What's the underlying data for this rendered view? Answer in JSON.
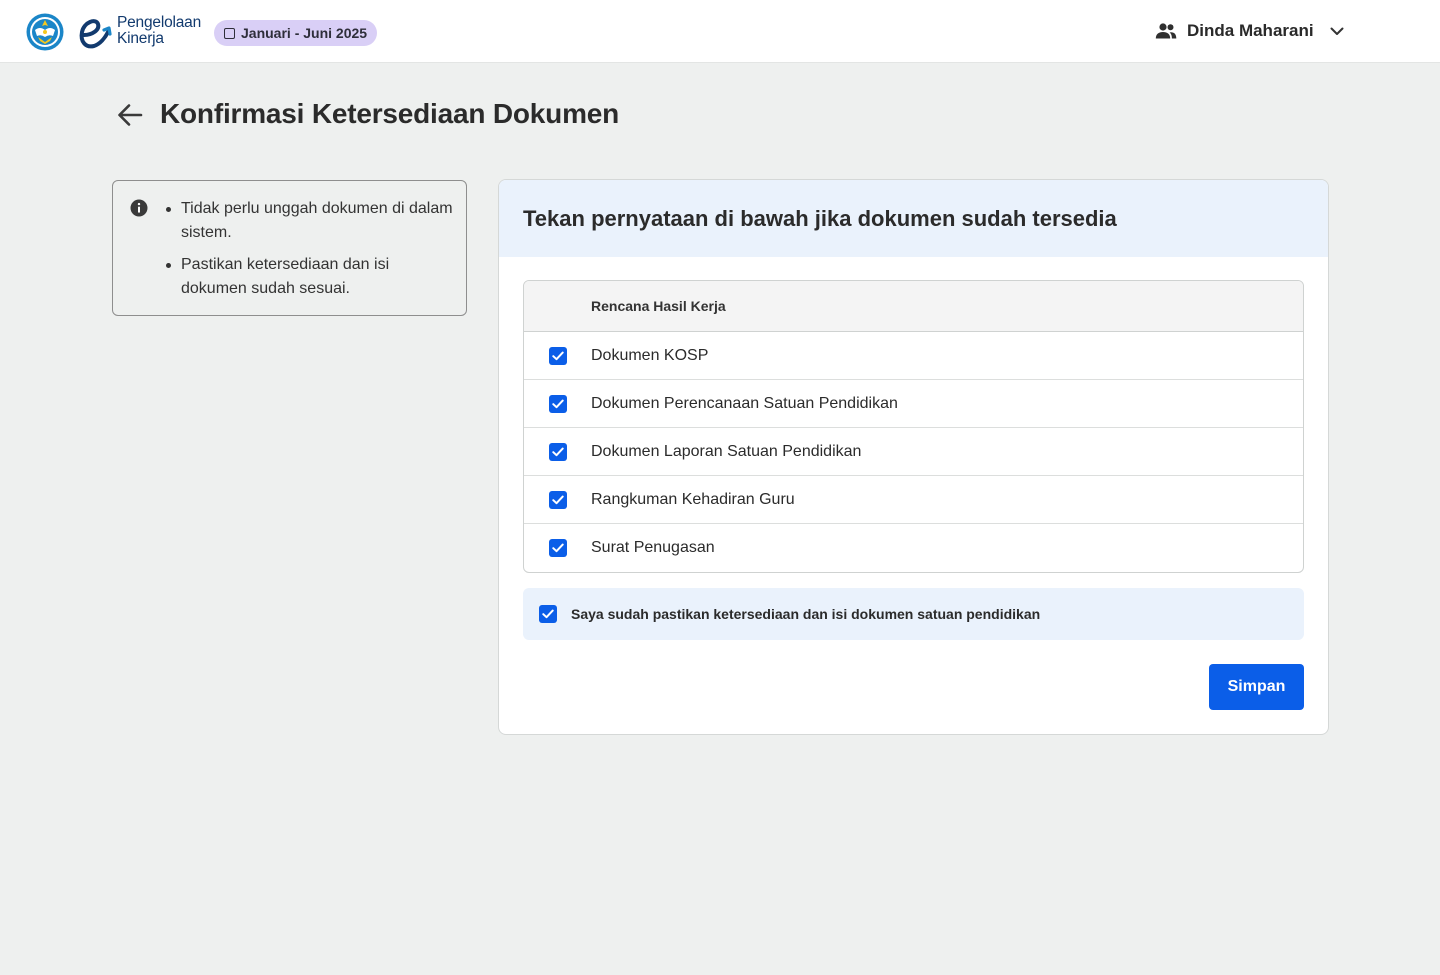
{
  "header": {
    "brand_line1": "Pengelolaan",
    "brand_line2": "Kinerja",
    "period": "Januari - Juni 2025",
    "user_name": "Dinda Maharani",
    "icons": {
      "emblem": "tut-wuri-handayani-emblem",
      "user": "users-icon",
      "dropdown": "chevron-down-icon"
    }
  },
  "page": {
    "title": "Konfirmasi Ketersediaan Dokumen",
    "back_icon": "arrow-left-icon"
  },
  "info": {
    "icon": "info-icon",
    "items": [
      "Tidak perlu unggah dokumen di dalam sistem.",
      "Pastikan ketersediaan dan isi dokumen sudah sesuai."
    ]
  },
  "card": {
    "title": "Tekan pernyataan di bawah jika dokumen sudah tersedia",
    "table_header": "Rencana Hasil Kerja",
    "documents": [
      {
        "label": "Dokumen KOSP",
        "checked": true
      },
      {
        "label": "Dokumen Perencanaan Satuan Pendidikan",
        "checked": true
      },
      {
        "label": "Dokumen Laporan Satuan Pendidikan",
        "checked": true
      },
      {
        "label": "Rangkuman Kehadiran Guru",
        "checked": true
      },
      {
        "label": "Surat Penugasan",
        "checked": true
      }
    ],
    "confirmation": {
      "label": "Saya sudah pastikan ketersediaan dan isi dokumen satuan pendidikan",
      "checked": true
    },
    "save_label": "Simpan"
  },
  "colors": {
    "primary": "#0b5ee8",
    "brand_navy": "#123a6e",
    "period_pill": "#d9cff6",
    "card_header_bg": "#eaf2fc",
    "page_bg": "#eef0ef"
  }
}
